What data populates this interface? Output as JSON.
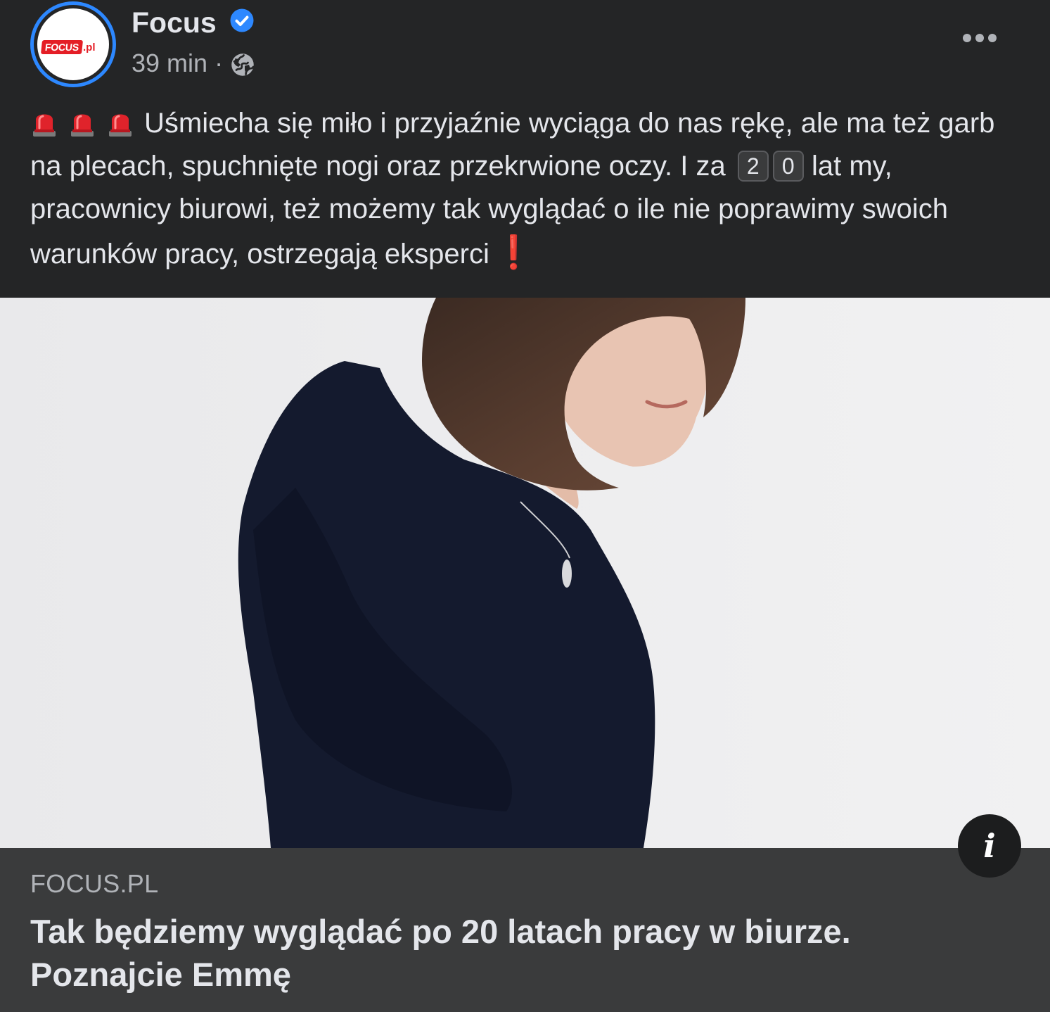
{
  "post": {
    "author": "Focus",
    "avatar_logo_text": "FOCUS",
    "avatar_logo_suffix": ".pl",
    "timestamp": "39 min",
    "separator": "·",
    "audience_icon": "globe-icon",
    "verified_icon": "verified-badge-icon",
    "more_icon": "more-options-icon",
    "text_part1": "Uśmiecha się miło i przyjaźnie wyciąga do nas rękę, ale ma też garb na plecach, spuchnięte nogi oraz przekrwione oczy. I za",
    "keycap_1": "2",
    "keycap_2": "0",
    "text_part2": "lat my, pracownicy biurowi, też możemy tak wyglądać o ile nie poprawimy swoich warunków pracy, ostrzegają eksperci",
    "exclamation": "❗",
    "leading_emoji": "police-siren-icon",
    "leading_emoji_count": 3
  },
  "link_preview": {
    "domain": "FOCUS.PL",
    "title": "Tak będziemy wyglądać po 20 latach pracy w biurze. Poznajcie Emmę",
    "info_icon_label": "i"
  },
  "colors": {
    "background": "#242526",
    "link_box": "#3a3b3c",
    "verified": "#2d88ff",
    "primary_text": "#e4e6eb",
    "secondary_text": "#b0b3b8"
  }
}
